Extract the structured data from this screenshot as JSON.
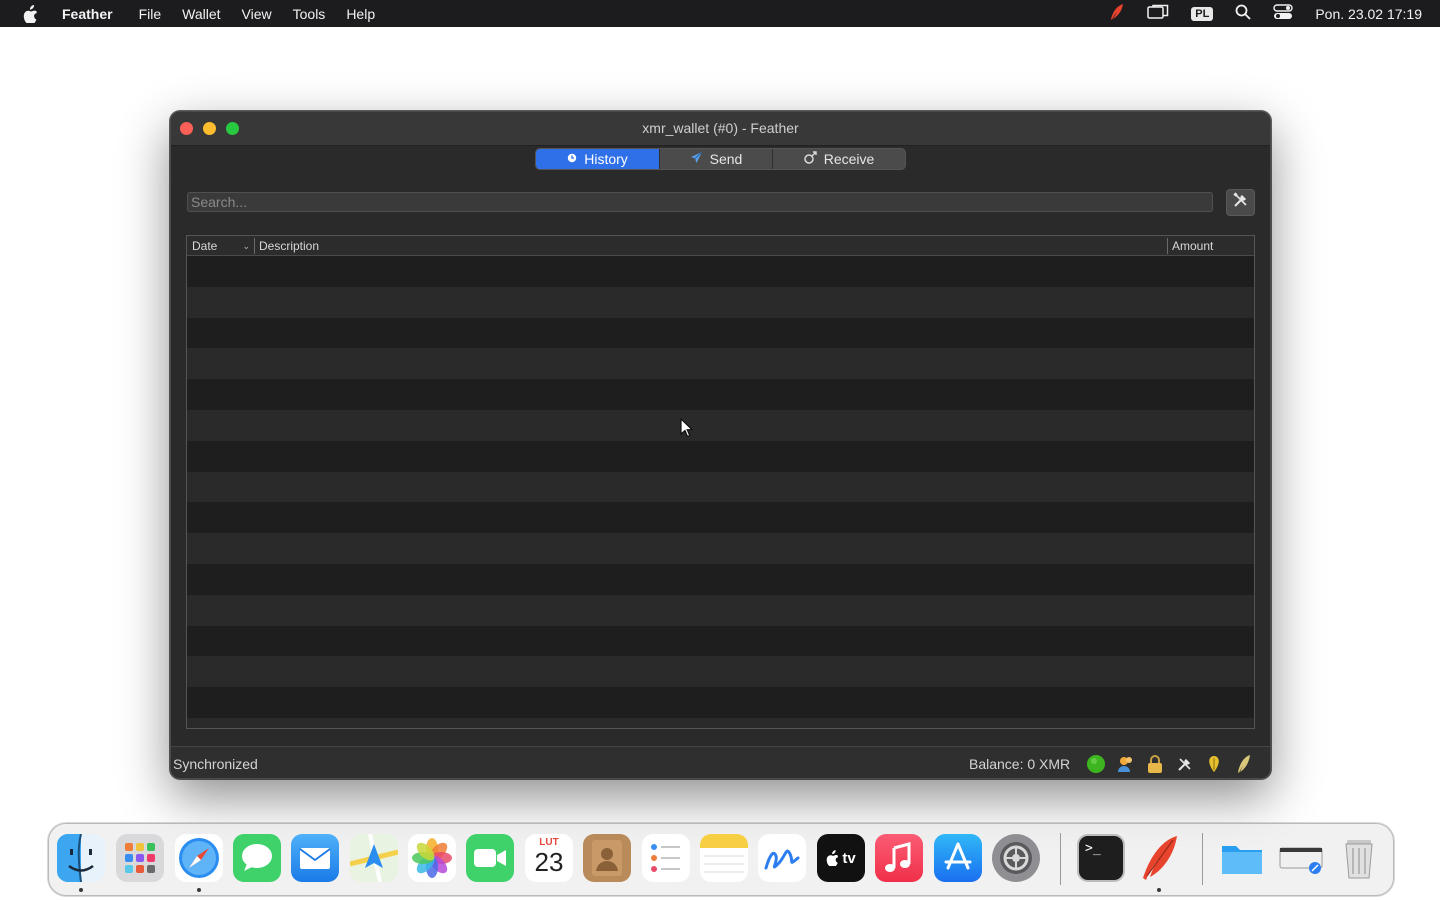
{
  "menubar": {
    "app_name": "Feather",
    "items": [
      "File",
      "Wallet",
      "View",
      "Tools",
      "Help"
    ],
    "input_source": "PL",
    "clock": "Pon. 23.02  17:19"
  },
  "window": {
    "title": "xmr_wallet (#0) - Feather",
    "tabs": [
      {
        "label": "History",
        "icon": "history-icon",
        "active": true
      },
      {
        "label": "Send",
        "icon": "send-icon",
        "active": false
      },
      {
        "label": "Receive",
        "icon": "receive-icon",
        "active": false
      }
    ],
    "search": {
      "placeholder": "Search...",
      "value": ""
    },
    "table": {
      "columns": [
        "Date",
        "Description",
        "Amount"
      ],
      "sort_column": "Date",
      "rows": []
    },
    "status": {
      "text": "Synchronized",
      "balance": "Balance: 0 XMR",
      "icons": [
        "connection-status-icon",
        "contacts-icon",
        "lock-icon",
        "settings-icon",
        "seed-icon",
        "feather-icon"
      ]
    }
  },
  "dock": {
    "apps": [
      {
        "name": "Finder",
        "icon": "finder-icon",
        "running": true
      },
      {
        "name": "Launchpad",
        "icon": "launchpad-icon",
        "running": false
      },
      {
        "name": "Safari",
        "icon": "safari-icon",
        "running": true
      },
      {
        "name": "Messages",
        "icon": "messages-icon",
        "running": false
      },
      {
        "name": "Mail",
        "icon": "mail-icon",
        "running": false
      },
      {
        "name": "Maps",
        "icon": "maps-icon",
        "running": false
      },
      {
        "name": "Photos",
        "icon": "photos-icon",
        "running": false
      },
      {
        "name": "FaceTime",
        "icon": "facetime-icon",
        "running": false
      },
      {
        "name": "Calendar",
        "icon": "calendar-icon",
        "running": false,
        "month": "LUT",
        "day": "23"
      },
      {
        "name": "Contacts",
        "icon": "contacts-icon",
        "running": false
      },
      {
        "name": "Reminders",
        "icon": "reminders-icon",
        "running": false
      },
      {
        "name": "Notes",
        "icon": "notes-icon",
        "running": false
      },
      {
        "name": "Freeform",
        "icon": "freeform-icon",
        "running": false
      },
      {
        "name": "TV",
        "icon": "tv-icon",
        "running": false,
        "label": "tv"
      },
      {
        "name": "Music",
        "icon": "music-icon",
        "running": false
      },
      {
        "name": "App Store",
        "icon": "appstore-icon",
        "running": false
      },
      {
        "name": "System Settings",
        "icon": "settings-icon",
        "running": false
      },
      {
        "name": "Terminal",
        "icon": "terminal-icon",
        "running": false
      },
      {
        "name": "Feather",
        "icon": "feather-icon",
        "running": true
      },
      {
        "name": "Downloads",
        "icon": "folder-icon",
        "running": false
      },
      {
        "name": "Finder window",
        "icon": "window-icon",
        "running": false
      },
      {
        "name": "Trash",
        "icon": "trash-icon",
        "running": false
      }
    ]
  },
  "colors": {
    "menubar_bg": "#1c1c1e",
    "window_bg": "#2a2a2a",
    "tab_active": "#2f6fe8",
    "close": "#fe5f57",
    "minimize": "#febc2e",
    "maximize": "#28c840",
    "sync_green": "#3cb521"
  }
}
